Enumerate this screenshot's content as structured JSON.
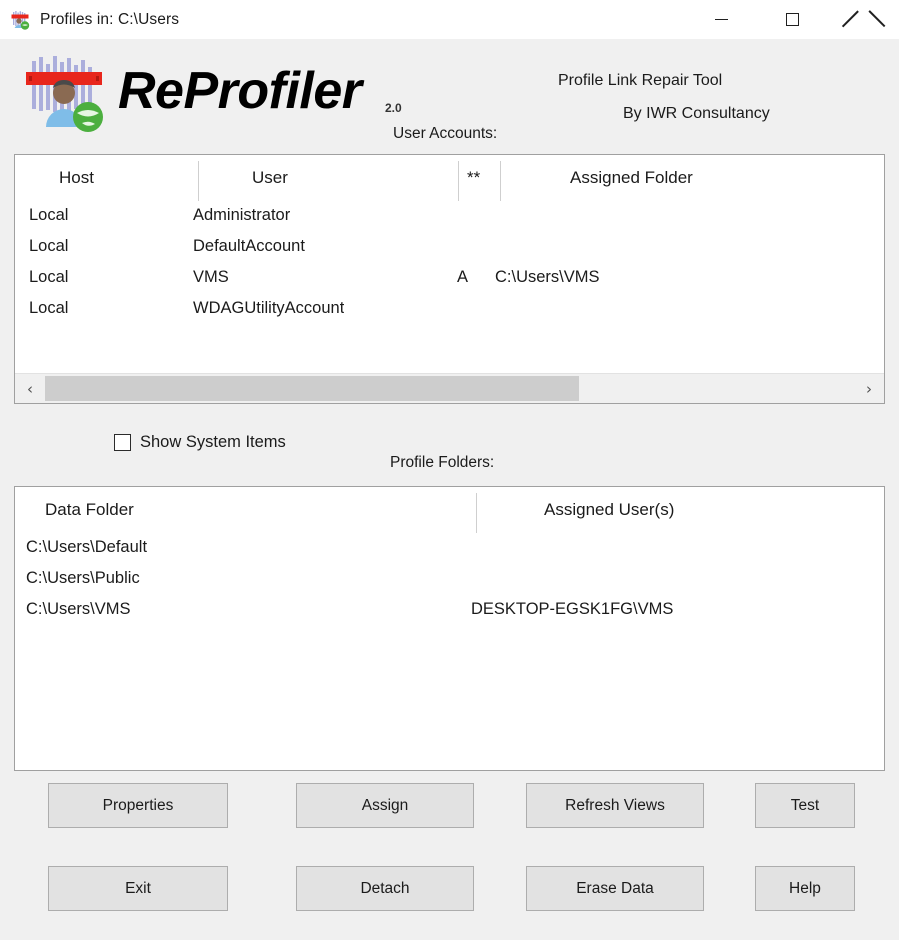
{
  "window": {
    "title": "Profiles in: C:\\Users",
    "icon": "reprofiler-app-icon",
    "controls": {
      "minimize": "minimize-icon",
      "maximize": "maximize-icon",
      "close": "close-icon"
    }
  },
  "header": {
    "logo": "reprofiler-logo",
    "product_name": "ReProfiler",
    "version": "2.0",
    "tagline": "Profile Link Repair Tool",
    "author": "By IWR Consultancy"
  },
  "user_accounts": {
    "section_label": "User Accounts:",
    "columns": [
      "Host",
      "User",
      "**",
      "Assigned Folder"
    ],
    "rows": [
      {
        "host": "Local",
        "user": "Administrator",
        "flag": "",
        "folder": ""
      },
      {
        "host": "Local",
        "user": "DefaultAccount",
        "flag": "",
        "folder": ""
      },
      {
        "host": "Local",
        "user": "VMS",
        "flag": "A",
        "folder": "C:\\Users\\VMS"
      },
      {
        "host": "Local",
        "user": "WDAGUtilityAccount",
        "flag": "",
        "folder": ""
      }
    ],
    "scrollbar": {
      "left_arrow": "‹",
      "right_arrow": "›",
      "thumb_width_pct": "66%"
    }
  },
  "options": {
    "show_system_items": {
      "label": "Show System Items",
      "checked": false
    }
  },
  "profile_folders": {
    "section_label": "Profile Folders:",
    "columns": [
      "Data Folder",
      "Assigned User(s)"
    ],
    "rows": [
      {
        "folder": "C:\\Users\\Default",
        "users": ""
      },
      {
        "folder": "C:\\Users\\Public",
        "users": ""
      },
      {
        "folder": "C:\\Users\\VMS",
        "users": "DESKTOP-EGSK1FG\\VMS"
      }
    ]
  },
  "buttons": {
    "properties": "Properties",
    "assign": "Assign",
    "refresh_views": "Refresh Views",
    "test": "Test",
    "exit": "Exit",
    "detach": "Detach",
    "erase_data": "Erase Data",
    "help": "Help"
  },
  "colors": {
    "window_background": "#f0f0f0",
    "listbox_background": "#ffffff",
    "listbox_border": "#a0a0a0",
    "button_face": "#e2e2e2",
    "button_border": "#adadad",
    "logo_banner": "#e8261c",
    "logo_bars": "#9a9ed8",
    "logo_globe": "#4caf3f",
    "text": "#1b1b1b"
  }
}
